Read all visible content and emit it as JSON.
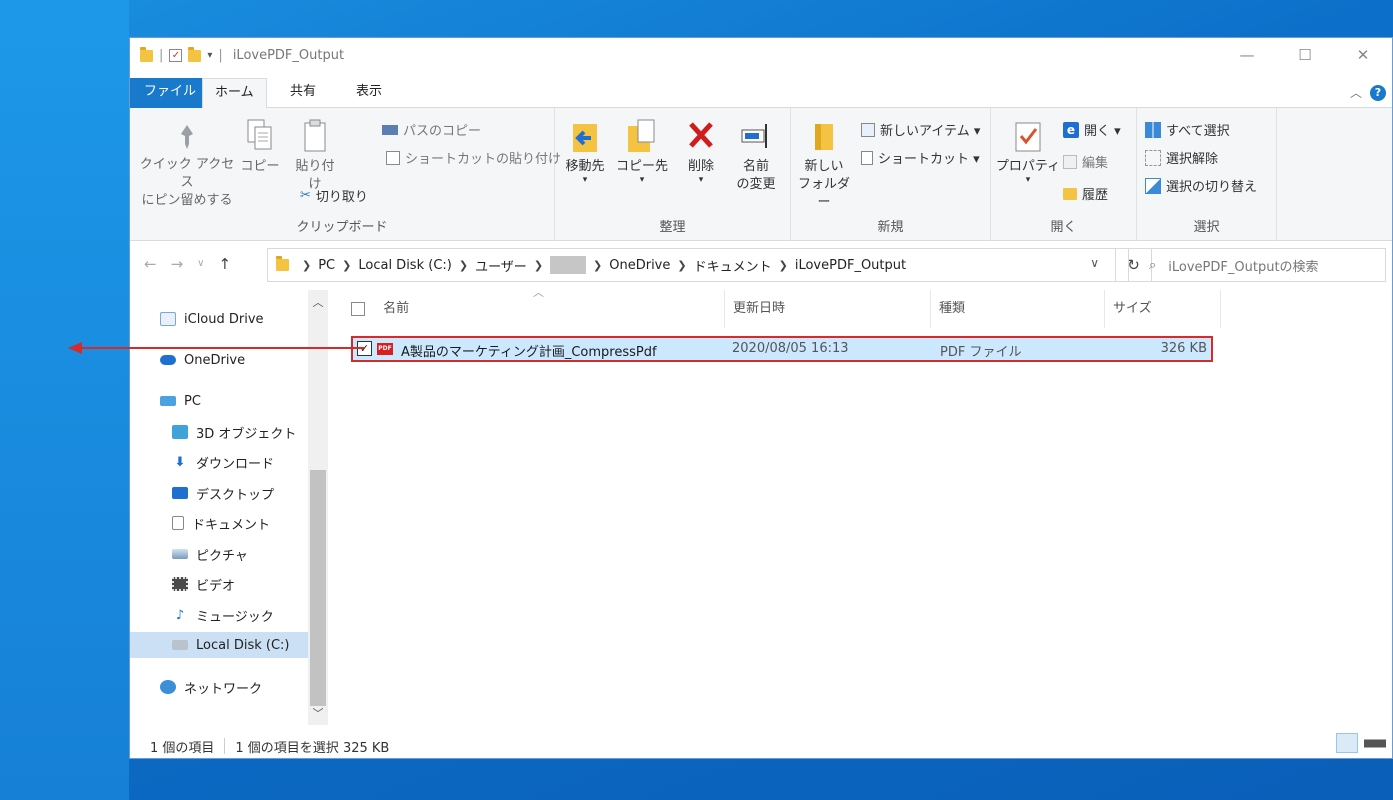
{
  "window": {
    "title": "iLovePDF_Output",
    "controls": {
      "minimize": "—",
      "maximize": "☐",
      "close": "✕"
    }
  },
  "tabs": [
    {
      "label": "ファイル",
      "active": false
    },
    {
      "label": "ホーム",
      "active": true
    },
    {
      "label": "共有",
      "active": false
    },
    {
      "label": "表示",
      "active": false
    }
  ],
  "ribbon": {
    "clipboard": {
      "label": "クリップボード",
      "pin_line1": "クイック アクセス",
      "pin_line2": "にピン留めする",
      "copy": "コピー",
      "paste": "貼り付け",
      "copy_path": "パスのコピー",
      "paste_shortcut": "ショートカットの貼り付け",
      "cut": "切り取り"
    },
    "organize": {
      "label": "整理",
      "move_to": "移動先",
      "copy_to": "コピー先",
      "delete": "削除",
      "rename_line1": "名前",
      "rename_line2": "の変更"
    },
    "new": {
      "label": "新規",
      "new_folder_line1": "新しい",
      "new_folder_line2": "フォルダー",
      "new_item": "新しいアイテム ▾",
      "shortcut": "ショートカット ▾"
    },
    "open": {
      "label": "開く",
      "properties": "プロパティ",
      "open": "開く ▾",
      "edit": "編集",
      "history": "履歴"
    },
    "select": {
      "label": "選択",
      "select_all": "すべて選択",
      "select_none": "選択解除",
      "invert": "選択の切り替え"
    }
  },
  "address": {
    "crumbs": [
      "PC",
      "Local Disk (C:)",
      "ユーザー",
      "",
      "OneDrive",
      "ドキュメント",
      "iLovePDF_Output"
    ],
    "search_placeholder": "iLovePDF_Outputの検索"
  },
  "nav": {
    "icloud": "iCloud Drive",
    "onedrive": "OneDrive",
    "pc": "PC",
    "objects3d": "3D オブジェクト",
    "downloads": "ダウンロード",
    "desktop": "デスクトップ",
    "documents": "ドキュメント",
    "pictures": "ピクチャ",
    "videos": "ビデオ",
    "music": "ミュージック",
    "localdisk": "Local Disk (C:)",
    "network": "ネットワーク"
  },
  "columns": {
    "name": "名前",
    "modified": "更新日時",
    "type": "種類",
    "size": "サイズ"
  },
  "files": [
    {
      "name": "A製品のマーケティング計画_CompressPdf",
      "modified": "2020/08/05 16:13",
      "type": "PDF ファイル",
      "size": "326 KB",
      "selected": true
    }
  ],
  "status": {
    "count": "1 個の項目",
    "selection": "1 個の項目を選択 325 KB"
  },
  "colors": {
    "accent": "#1979ca",
    "highlight": "#d62b2b",
    "selection": "#cce8ff"
  }
}
